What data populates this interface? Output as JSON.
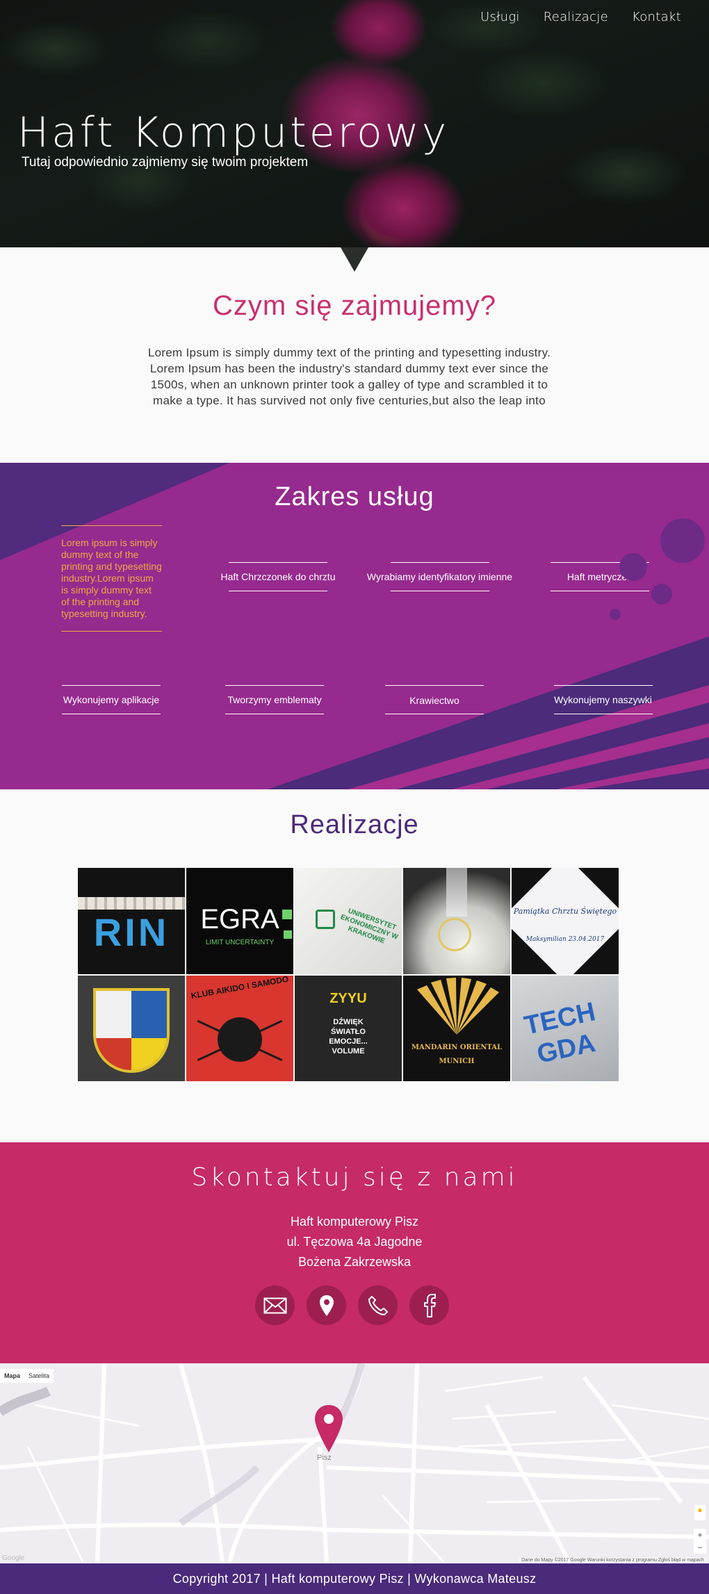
{
  "nav": {
    "items": [
      "Usługi",
      "Realizacje",
      "Kontakt"
    ]
  },
  "hero": {
    "title": "Haft Komputerowy",
    "subtitle": "Tutaj odpowiednio zajmiemy się twoim projektem"
  },
  "about": {
    "heading": "Czym się zajmujemy?",
    "text": "Lorem Ipsum is simply dummy text of the printing and typesetting industry. Lorem Ipsum has been the industry's standard dummy text ever since the 1500s, when an unknown printer took a galley of type and scrambled it to make a type. It has survived not only five centuries,but also the leap into"
  },
  "services": {
    "heading": "Zakres usług",
    "lead": "Lorem ipsum is simply dummy text of the printing and typesetting industry.Lorem ipsum is simply dummy text of the printing and typesetting industry.",
    "items": [
      "Haft Chrzczonek do chrztu",
      "Wyrabiamy identyfikatory imienne",
      "Haft metryczek",
      "Wykonujemy aplikacje",
      "Tworzymy emblematy",
      "Krawiectwo",
      "Wykonujemy naszywki"
    ]
  },
  "realizations": {
    "heading": "Realizacje",
    "tiles": [
      {
        "caption": "RIN",
        "bg": "#121212",
        "fg": "#3aa0e0"
      },
      {
        "caption": "EGRA",
        "sub": "LIMIT UNCERTAINTY",
        "bg": "#0a0a0a",
        "fg": "#ffffff"
      },
      {
        "caption": "UNIWERSYTET EKONOMICZNY W KRAKOWIE",
        "bg": "#e8e8e6",
        "fg": "#1f8a45"
      },
      {
        "caption": "",
        "bg": "#3a3a3a",
        "fg": "#e8d070"
      },
      {
        "caption": "Pamiątka Chrztu Świętego",
        "sub": "Maksymilian 23.04.2017",
        "bg": "#111111",
        "fg": "#1c3a7a"
      },
      {
        "caption": "",
        "bg": "#3d3d3d",
        "fg": "#e0c030"
      },
      {
        "caption": "KLUB AIKIDO I SAMODO",
        "bg": "#d8362e",
        "fg": "#111111"
      },
      {
        "caption": "ZYYU",
        "sub": "DŹWIĘK ŚWIATŁO EMOCJE... VOLUME",
        "bg": "#262626",
        "fg": "#f0d020"
      },
      {
        "caption": "MANDARIN ORIENTAL",
        "sub": "MUNICH",
        "bg": "#111111",
        "fg": "#e6b84a"
      },
      {
        "caption": "TECH GDA",
        "bg": "#bfc3c7",
        "fg": "#2a64c0"
      }
    ]
  },
  "contact": {
    "heading": "Skontaktuj się z nami",
    "lines": [
      "Haft komputerowy Pisz",
      "ul. Tęczowa 4a Jagodne",
      "Bożena Zakrzewska"
    ],
    "icons": [
      "envelope-icon",
      "location-pin-icon",
      "phone-icon",
      "facebook-icon"
    ]
  },
  "map": {
    "tabs": [
      "Mapa",
      "Satelita"
    ],
    "place_label": "Pisz",
    "attribution": "Dane do Mapy ©2017 Google   Warunki korzystania z programu   Zgłoś błąd w mapach",
    "google": "Google"
  },
  "footer": {
    "text": "Copyright 2017 | Haft komputerowy Pisz | Wykonawca Mateusz"
  },
  "colors": {
    "accent": "#c62a67",
    "purple": "#962a8e",
    "deep": "#4a2a7a",
    "orange": "#f2a846"
  }
}
